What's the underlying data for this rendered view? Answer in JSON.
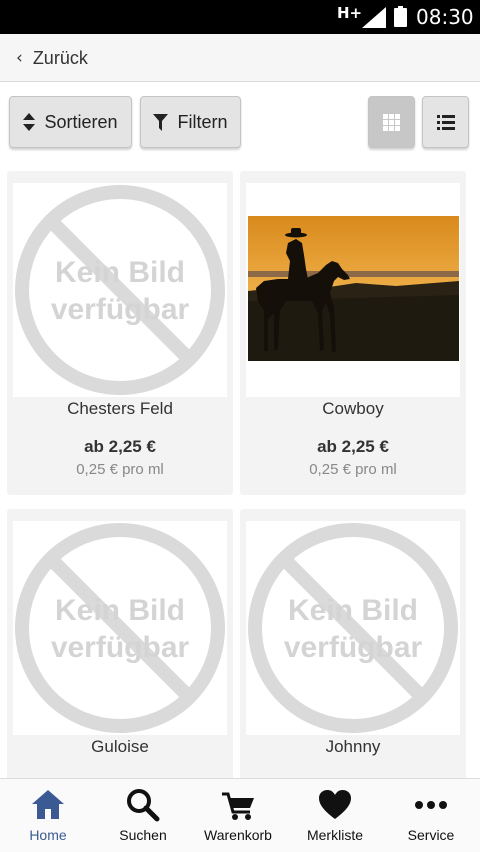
{
  "status_bar": {
    "network": "H+",
    "time": "08:30"
  },
  "header": {
    "back_label": "Zurück"
  },
  "toolbar": {
    "sort_label": "Sortieren",
    "filter_label": "Filtern",
    "view_mode": "grid"
  },
  "placeholder": {
    "line1": "Kein Bild",
    "line2": "verfügbar"
  },
  "products": [
    {
      "name": "Chesters Feld",
      "price": "ab 2,25 €",
      "unit_price": "0,25 € pro ml",
      "image": "placeholder"
    },
    {
      "name": "Cowboy",
      "price": "ab 2,25 €",
      "unit_price": "0,25 € pro ml",
      "image": "cowboy-sunset-photo"
    },
    {
      "name": "Guloise",
      "image": "placeholder"
    },
    {
      "name": "Johnny",
      "image": "placeholder"
    }
  ],
  "bottom_nav": {
    "items": [
      {
        "label": "Home",
        "icon": "home-icon",
        "active": true
      },
      {
        "label": "Suchen",
        "icon": "search-icon",
        "active": false
      },
      {
        "label": "Warenkorb",
        "icon": "cart-icon",
        "active": false
      },
      {
        "label": "Merkliste",
        "icon": "heart-icon",
        "active": false
      },
      {
        "label": "Service",
        "icon": "more-icon",
        "active": false
      }
    ]
  },
  "colors": {
    "accent": "#3b5a93",
    "placeholder_gray": "#d9d9d9",
    "card_bg": "#f3f3f3"
  }
}
